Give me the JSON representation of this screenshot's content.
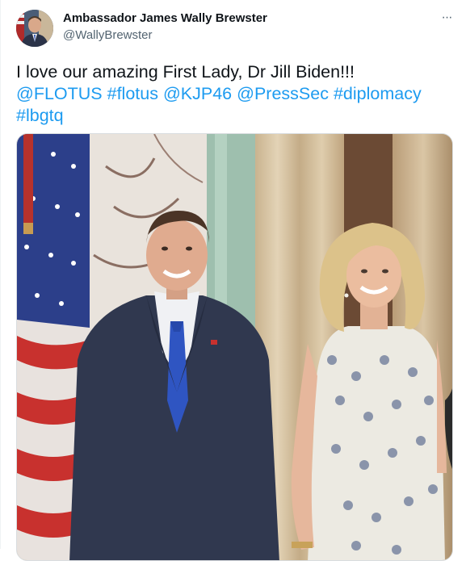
{
  "tweet": {
    "author": {
      "name": "Ambassador James Wally Brewster",
      "handle": "@WallyBrewster",
      "avatar_icon": "avatar-photo"
    },
    "more_icon": "ellipsis-icon",
    "more_label": "···",
    "text": {
      "line1": "I love our amazing First Lady, Dr Jill Biden!!!",
      "line2_parts": [
        "@FLOTUS",
        "#flotus",
        "@KJP46",
        "@PressSec",
        "#diplomacy"
      ],
      "line3_parts": [
        "#lbgtq"
      ]
    },
    "media": {
      "icon": "photo-two-people-with-flag"
    }
  },
  "colors": {
    "link": "#1d9bf0",
    "text": "#0f1419",
    "secondary": "#536471"
  }
}
